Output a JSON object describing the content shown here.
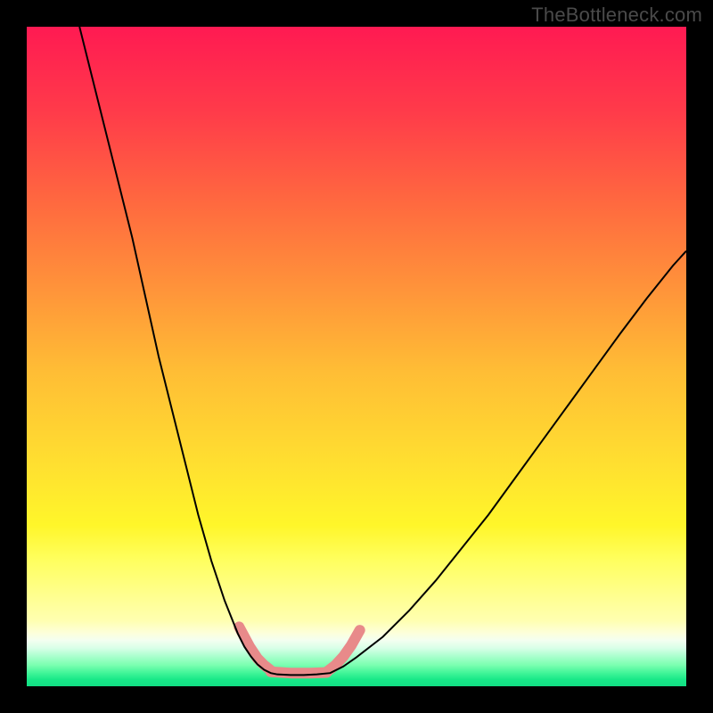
{
  "watermark": "TheBottleneck.com",
  "colors": {
    "page_bg": "#000000",
    "curve": "#000000",
    "highlight": "#e88a8a",
    "gradient_top": "#ff1a52",
    "gradient_mid": "#ffe030",
    "gradient_bottom": "#12df84"
  },
  "chart_data": {
    "type": "line",
    "title": "",
    "xlabel": "",
    "ylabel": "",
    "xlim": [
      0,
      100
    ],
    "ylim": [
      0,
      100
    ],
    "note": "Axes unlabeled; values are percent of plot area. Background is a vertical color gradient (red→yellow→green). Two black curves descend from the top edges to a minimum near the bottom center and rise again. A salmon highlight marks the trough region.",
    "series": [
      {
        "name": "left_curve",
        "x": [
          8,
          10,
          12,
          14,
          16,
          18,
          20,
          22,
          24,
          26,
          28,
          30,
          32,
          33,
          34,
          35,
          36,
          37,
          38
        ],
        "y": [
          100,
          92,
          84,
          76,
          68,
          59,
          50,
          42,
          34,
          26,
          19,
          13,
          8,
          6,
          4.5,
          3.3,
          2.5,
          2.0,
          1.8
        ]
      },
      {
        "name": "flat_bottom",
        "x": [
          38,
          40,
          42,
          44,
          46
        ],
        "y": [
          1.8,
          1.7,
          1.7,
          1.8,
          2.0
        ]
      },
      {
        "name": "right_curve",
        "x": [
          46,
          48,
          50,
          54,
          58,
          62,
          66,
          70,
          74,
          78,
          82,
          86,
          90,
          94,
          98,
          100
        ],
        "y": [
          2.0,
          3.0,
          4.4,
          7.5,
          11.5,
          16,
          21,
          26,
          31.5,
          37,
          42.5,
          48,
          53.5,
          58.8,
          63.8,
          66
        ]
      }
    ],
    "annotations": [
      {
        "name": "trough_highlight_left",
        "x": [
          32.2,
          33.8,
          35.0,
          36.0,
          37.0
        ],
        "y": [
          9.0,
          6.0,
          4.2,
          3.2,
          2.4
        ]
      },
      {
        "name": "trough_highlight_bottom",
        "x": [
          37.0,
          40.0,
          43.0,
          45.5
        ],
        "y": [
          2.2,
          2.0,
          2.0,
          2.1
        ]
      },
      {
        "name": "trough_highlight_right",
        "x": [
          45.5,
          46.8,
          48.0,
          49.2,
          50.5
        ],
        "y": [
          2.2,
          3.2,
          4.5,
          6.2,
          8.5
        ]
      }
    ]
  }
}
